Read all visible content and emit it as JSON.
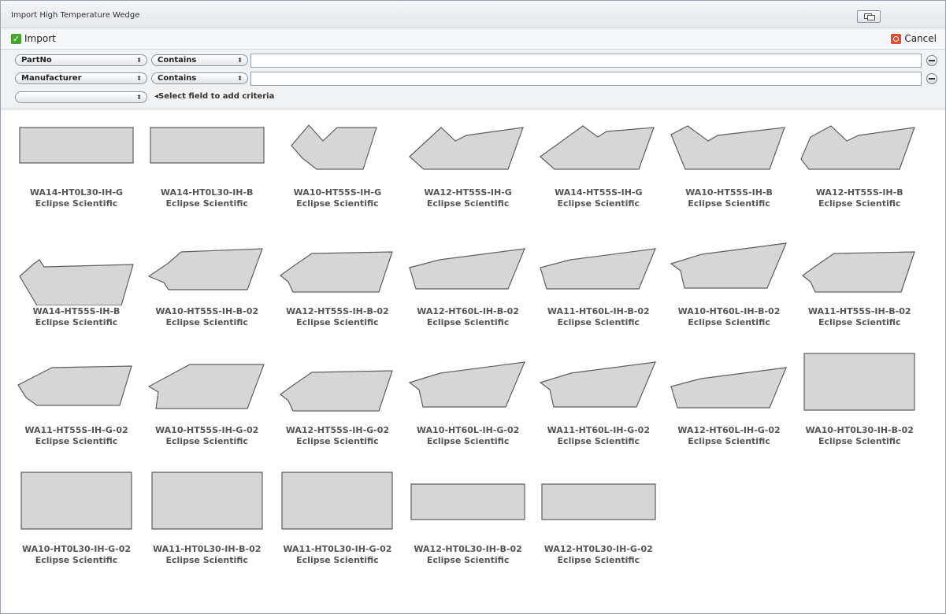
{
  "window": {
    "title": "Import High Temperature Wedge"
  },
  "toolbar": {
    "import_label": "Import",
    "cancel_label": "Cancel"
  },
  "filters": [
    {
      "field": "PartNo",
      "operator": "Contains",
      "value": ""
    },
    {
      "field": "Manufacturer",
      "operator": "Contains",
      "value": ""
    }
  ],
  "add_criteria": {
    "field": "",
    "hint": "Select field to add criteria"
  },
  "items": [
    {
      "part": "WA14-HT0L30-IH-G",
      "manufacturer": "Eclipse Scientific",
      "shape": "rect-wide"
    },
    {
      "part": "WA14-HT0L30-IH-B",
      "manufacturer": "Eclipse Scientific",
      "shape": "rect-wide"
    },
    {
      "part": "WA10-HT55S-IH-G",
      "manufacturer": "Eclipse Scientific",
      "shape": "notch-deep"
    },
    {
      "part": "WA12-HT55S-IH-G",
      "manufacturer": "Eclipse Scientific",
      "shape": "notch-mid"
    },
    {
      "part": "WA14-HT55S-IH-G",
      "manufacturer": "Eclipse Scientific",
      "shape": "notch-wide"
    },
    {
      "part": "WA10-HT55S-IH-B",
      "manufacturer": "Eclipse Scientific",
      "shape": "notch-deep-b"
    },
    {
      "part": "WA12-HT55S-IH-B",
      "manufacturer": "Eclipse Scientific",
      "shape": "notch-mid-b"
    },
    {
      "part": "WA14-HT55S-IH-B",
      "manufacturer": "Eclipse Scientific",
      "shape": "notch-small"
    },
    {
      "part": "WA10-HT55S-IH-B-02",
      "manufacturer": "Eclipse Scientific",
      "shape": "para-55"
    },
    {
      "part": "WA12-HT55S-IH-B-02",
      "manufacturer": "Eclipse Scientific",
      "shape": "para-55-flat"
    },
    {
      "part": "WA12-HT60L-IH-B-02",
      "manufacturer": "Eclipse Scientific",
      "shape": "para-60"
    },
    {
      "part": "WA11-HT60L-IH-B-02",
      "manufacturer": "Eclipse Scientific",
      "shape": "para-60"
    },
    {
      "part": "WA10-HT60L-IH-B-02",
      "manufacturer": "Eclipse Scientific",
      "shape": "para-60-tall"
    },
    {
      "part": "WA11-HT55S-IH-B-02",
      "manufacturer": "Eclipse Scientific",
      "shape": "para-55-flat"
    },
    {
      "part": "WA11-HT55S-IH-G-02",
      "manufacturer": "Eclipse Scientific",
      "shape": "para-55-g"
    },
    {
      "part": "WA10-HT55S-IH-G-02",
      "manufacturer": "Eclipse Scientific",
      "shape": "para-55-tall"
    },
    {
      "part": "WA12-HT55S-IH-G-02",
      "manufacturer": "Eclipse Scientific",
      "shape": "para-55-flat"
    },
    {
      "part": "WA10-HT60L-IH-G-02",
      "manufacturer": "Eclipse Scientific",
      "shape": "para-60-tall"
    },
    {
      "part": "WA11-HT60L-IH-G-02",
      "manufacturer": "Eclipse Scientific",
      "shape": "para-60-tall"
    },
    {
      "part": "WA12-HT60L-IH-G-02",
      "manufacturer": "Eclipse Scientific",
      "shape": "para-60"
    },
    {
      "part": "WA10-HT0L30-IH-B-02",
      "manufacturer": "Eclipse Scientific",
      "shape": "rect-tall"
    },
    {
      "part": "WA10-HT0L30-IH-G-02",
      "manufacturer": "Eclipse Scientific",
      "shape": "rect-tall"
    },
    {
      "part": "WA11-HT0L30-IH-B-02",
      "manufacturer": "Eclipse Scientific",
      "shape": "rect-tall"
    },
    {
      "part": "WA11-HT0L30-IH-G-02",
      "manufacturer": "Eclipse Scientific",
      "shape": "rect-tall"
    },
    {
      "part": "WA12-HT0L30-IH-B-02",
      "manufacturer": "Eclipse Scientific",
      "shape": "rect-wide"
    },
    {
      "part": "WA12-HT0L30-IH-G-02",
      "manufacturer": "Eclipse Scientific",
      "shape": "rect-wide"
    }
  ]
}
